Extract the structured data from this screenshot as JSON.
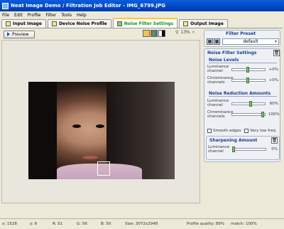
{
  "window": {
    "title": "Neat Image Demo / Filtration Job Editor - IMG_6799.JPG"
  },
  "menu": [
    "File",
    "Edit",
    "Profile",
    "Filter",
    "Tools",
    "Help"
  ],
  "tabs": [
    {
      "label": "Input Image",
      "active": false
    },
    {
      "label": "Device Noise Profile",
      "active": false
    },
    {
      "label": "Noise Filter Settings",
      "active": true
    },
    {
      "label": "Output Image",
      "active": false
    }
  ],
  "toolbar": {
    "preview_label": "Preview",
    "zoom_value": "13%"
  },
  "filter_preset": {
    "title": "Filter Preset",
    "selected": "default"
  },
  "noise_filter": {
    "title": "Noise Filter Settings",
    "noise_levels": {
      "title": "Noise Levels",
      "luminance_label": "Luminance channel",
      "luminance_value": "+0%",
      "luminance_level": 0.5,
      "chrominance_label": "Chrominance channels",
      "chrominance_value": "+0%",
      "chrominance_level": 0.5
    },
    "noise_reduction": {
      "title": "Noise Reduction Amounts",
      "luminance_label": "Luminance channel",
      "luminance_value": "60%",
      "luminance_level": 0.6,
      "chrominance_label": "Chrominance channels",
      "chrominance_value": "100%",
      "chrominance_level": 1.0
    },
    "smooth_edges_label": "Smooth edges",
    "very_low_freq_label": "Very low freq"
  },
  "sharpening": {
    "title": "Sharpening Amount",
    "luminance_label": "Luminance channel",
    "luminance_value": "0%",
    "luminance_level": 0.0
  },
  "status": {
    "x": "x: 1528",
    "y": "y: 8",
    "r": "R: 51",
    "g": "G: 56",
    "b": "B: 50",
    "size": "Size: 3072x2048",
    "quality": "Profile quality: 89%",
    "match": "match: 100%"
  }
}
